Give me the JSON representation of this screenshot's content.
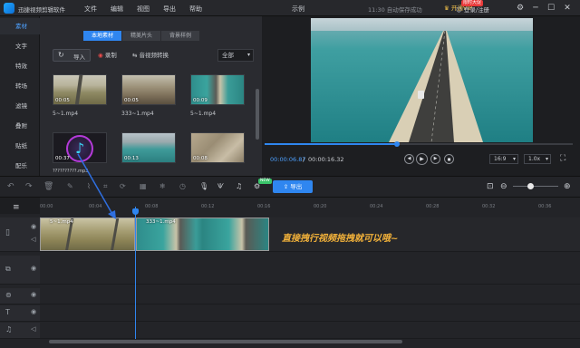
{
  "app": {
    "title": "迅捷视频剪辑软件",
    "menu": [
      "文件",
      "编辑",
      "视图",
      "导出",
      "帮助"
    ],
    "project_name": "示例",
    "autosave": "11:30 自动保存成功",
    "vip_label": "开通VIP",
    "vip_badge": "限时大促",
    "login": "登录/注册"
  },
  "sidebar": {
    "items": [
      {
        "label": "素材"
      },
      {
        "label": "文字"
      },
      {
        "label": "特效"
      },
      {
        "label": "转场"
      },
      {
        "label": "滤镜"
      },
      {
        "label": "叠附"
      },
      {
        "label": "贴纸"
      },
      {
        "label": "配乐"
      }
    ],
    "active_index": 0
  },
  "media": {
    "tabs": [
      "本地素材",
      "精美片头",
      "背景样例"
    ],
    "active_tab": 0,
    "import_label": "导入",
    "record_label": "录制",
    "convert_label": "音视频转换",
    "filter_value": "全部",
    "items": [
      {
        "duration": "00:05",
        "name": "5~1.mp4"
      },
      {
        "duration": "00:05",
        "name": "333~1.mp4"
      },
      {
        "duration": "00:09",
        "name": "5~1.mp4"
      },
      {
        "duration": "00:37",
        "name": "??????????.mp3"
      },
      {
        "duration": "00:13",
        "name": ""
      },
      {
        "duration": "00:08",
        "name": ""
      }
    ]
  },
  "preview": {
    "current_time": "00:00:06.87",
    "separator": "/",
    "total_time": "00:00:16.32",
    "progress": 0.42,
    "aspect": "16:9",
    "speed": "1.0x"
  },
  "toolbar": {
    "export_label": "导出",
    "new_badge": "NEW"
  },
  "ruler": {
    "ticks": [
      "00:00",
      "00:04",
      "00:08",
      "00:12",
      "00:16",
      "00:20",
      "00:24",
      "00:28",
      "00:32",
      "00:36"
    ]
  },
  "timeline": {
    "clips": [
      {
        "label": "5~1.mp4"
      },
      {
        "label": "333~1.mp4"
      }
    ],
    "annotation": "直接拽行视频拖拽就可以哦~"
  },
  "colors": {
    "accent": "#2f86f0",
    "annotation": "#f3b23a",
    "vip": "#f3c24a"
  }
}
